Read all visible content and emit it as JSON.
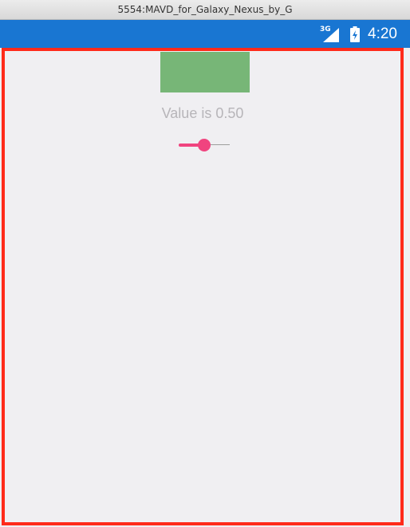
{
  "window": {
    "title": "5554:MAVD_for_Galaxy_Nexus_by_G"
  },
  "statusbar": {
    "network_type": "3G",
    "time": "4:20",
    "color": "#1976d2",
    "icons": [
      "signal-icon",
      "battery-icon"
    ]
  },
  "content": {
    "value_label": "Value is 0.50",
    "slider_value": 0.5,
    "accent_color": "#f0447f",
    "box_color": "#77b677",
    "border_color": "#ff2a1a"
  }
}
